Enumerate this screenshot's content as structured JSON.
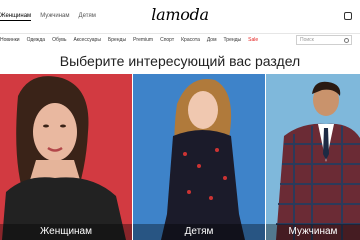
{
  "header": {
    "nav": [
      "Женщинам",
      "Мужчинам",
      "Детям"
    ],
    "logo": "lamoda"
  },
  "categories": {
    "items": [
      "Новинки",
      "Одежда",
      "Обувь",
      "Аксессуары",
      "Бренды",
      "Premium",
      "Спорт",
      "Красота",
      "Дом",
      "Тренды"
    ],
    "sale": "Sale",
    "search_placeholder": "Поиск"
  },
  "headline": "Выберите интересующий вас раздел",
  "tiles": [
    {
      "label": "Женщинам",
      "color": "#d23a41"
    },
    {
      "label": "Детям",
      "color": "#3e83c9"
    },
    {
      "label": "Мужчинам",
      "color": "#7fb8db"
    }
  ]
}
